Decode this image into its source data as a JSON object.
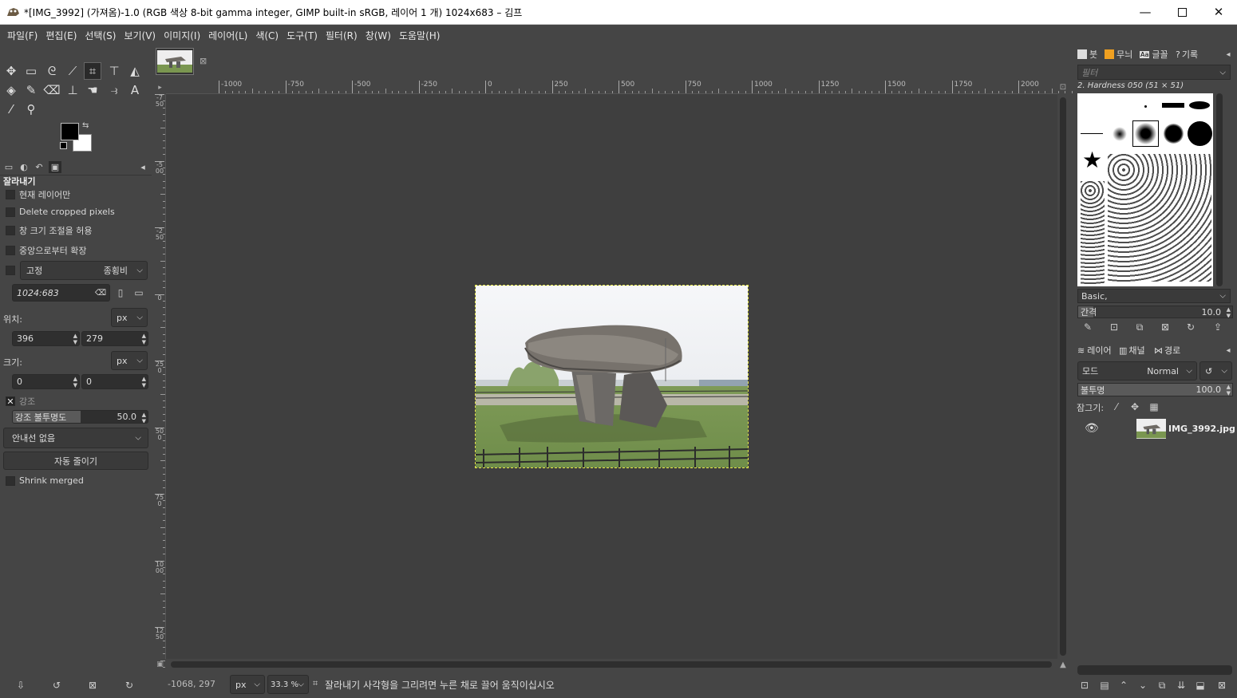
{
  "window": {
    "title": "*[IMG_3992] (가져옴)-1.0 (RGB 색상 8-bit gamma integer, GIMP built-in sRGB, 레이어 1 개) 1024x683 – 김프",
    "minimize_icon": "minimize-icon",
    "maximize_icon": "maximize-icon",
    "close_icon": "close-icon"
  },
  "menu": [
    "파일(F)",
    "편집(E)",
    "선택(S)",
    "보기(V)",
    "이미지(I)",
    "레이어(L)",
    "색(C)",
    "도구(T)",
    "필터(R)",
    "창(W)",
    "도움말(H)"
  ],
  "tool_options": {
    "title": "잘라내기",
    "current_layer_only": "현재 레이어만",
    "delete_cropped": "Delete cropped pixels",
    "allow_growing": "창 크기 조절을 허용",
    "expand_center": "중앙으로부터 확장",
    "fixed_label": "고정",
    "fixed_value": "종횡비",
    "ratio_value": "1024:683",
    "position_label": "위치:",
    "position_unit": "px",
    "position_x": "396",
    "position_y": "279",
    "size_label": "크기:",
    "size_unit": "px",
    "size_w": "0",
    "size_h": "0",
    "highlight_label": "강조",
    "highlight_opacity_label": "강조 불투명도",
    "highlight_opacity_value": "50.0",
    "highlight_opacity_fraction": 0.5,
    "guides_value": "안내선 없음",
    "auto_shrink": "자동 줄이기",
    "shrink_merged": "Shrink merged"
  },
  "status": {
    "coords": "-1068, 297",
    "unit": "px",
    "zoom": "33.3 %",
    "message": "잘라내기 사각형을 그리려면 누른 채로 끌어 움직이십시오"
  },
  "ruler": {
    "h_labels": [
      "-1000",
      "-750",
      "-500",
      "-250",
      "0",
      "250",
      "500",
      "750",
      "1000",
      "1250",
      "1500",
      "1750",
      "2000"
    ],
    "v_labels": [
      "-750",
      "-500",
      "-250",
      "0",
      "250",
      "500",
      "750",
      "1000",
      "1250"
    ]
  },
  "brushes": {
    "tab_brushes": "붓",
    "tab_patterns": "무늬",
    "tab_fonts": "글꼴",
    "tab_history": "기록",
    "filter_placeholder": "필터",
    "selected_brush": "2. Hardness 050 (51 × 51)",
    "tag": "Basic,",
    "spacing_label": "간격",
    "spacing_value": "10.0",
    "spacing_fraction": 0.1
  },
  "layers": {
    "tab_layers": "레이어",
    "tab_channels": "채널",
    "tab_paths": "경로",
    "mode_label": "모드",
    "mode_value": "Normal",
    "opacity_label": "불투명",
    "opacity_value": "100.0",
    "opacity_fraction": 1.0,
    "lock_label": "잠그기:",
    "items": [
      {
        "name": "IMG_3992.jpg",
        "visible": true
      }
    ]
  },
  "colors": {
    "foreground": "#000000",
    "background": "#ffffff",
    "selection_dash": "#e8e84a"
  }
}
